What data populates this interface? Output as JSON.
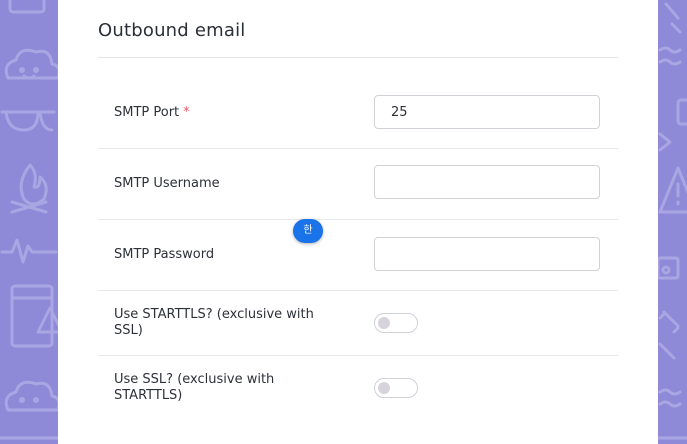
{
  "section": {
    "title": "Outbound email"
  },
  "fields": {
    "smtp_port": {
      "label": "SMTP Port",
      "required_mark": "*",
      "value": "25"
    },
    "smtp_username": {
      "label": "SMTP Username",
      "value": ""
    },
    "smtp_password": {
      "label": "SMTP Password",
      "value": ""
    },
    "use_starttls": {
      "label": "Use STARTTLS? (exclusive with SSL)",
      "checked": false
    },
    "use_ssl": {
      "label": "Use SSL? (exclusive with STARTTLS)",
      "checked": false
    }
  },
  "ime_indicator": {
    "text": "한"
  },
  "colors": {
    "background": "#8e8ad8",
    "doodle": "#a9a6e3",
    "panel": "#ffffff",
    "required": "#e35d6a",
    "ime_badge": "#1a73e8"
  }
}
